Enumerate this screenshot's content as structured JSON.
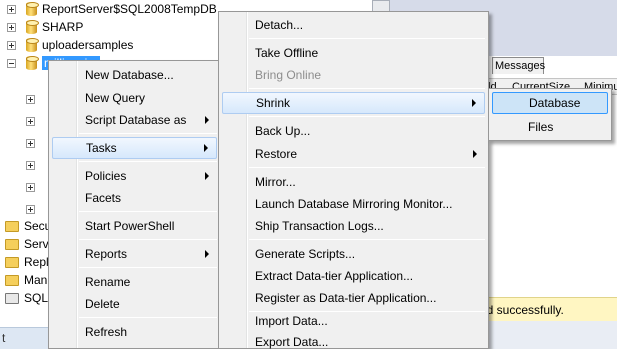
{
  "tree": {
    "items": [
      {
        "label": "ReportServer$SQL2008TempDB",
        "type": "database"
      },
      {
        "label": "SHARP",
        "type": "database"
      },
      {
        "label": "uploadersamples",
        "type": "database"
      },
      {
        "label": "millionaire",
        "type": "database",
        "selected": true
      }
    ],
    "folders": [
      {
        "label": "Secu"
      },
      {
        "label": "Serv"
      },
      {
        "label": "Repl"
      },
      {
        "label": "Man"
      },
      {
        "label": "SQL"
      }
    ],
    "status_text": "t"
  },
  "results": {
    "messages_tab": "Messages",
    "columns": [
      "ld",
      "CurrentSize",
      "Minimu"
    ],
    "status_message": "ed successfully."
  },
  "context_menu": {
    "items": [
      {
        "label": "New Database..."
      },
      {
        "label": "New Query"
      },
      {
        "label": "Script Database as",
        "submenu": true
      },
      {
        "label": "Tasks",
        "submenu": true,
        "highlighted": true
      },
      {
        "label": "Policies",
        "submenu": true
      },
      {
        "label": "Facets"
      },
      {
        "label": "Start PowerShell"
      },
      {
        "label": "Reports",
        "submenu": true
      },
      {
        "label": "Rename"
      },
      {
        "label": "Delete"
      },
      {
        "label": "Refresh"
      }
    ]
  },
  "tasks_menu": {
    "items": [
      {
        "label": "Detach..."
      },
      {
        "label": "Take Offline"
      },
      {
        "label": "Bring Online",
        "disabled": true
      },
      {
        "label": "Shrink",
        "submenu": true,
        "highlighted": true
      },
      {
        "label": "Back Up..."
      },
      {
        "label": "Restore",
        "submenu": true
      },
      {
        "label": "Mirror..."
      },
      {
        "label": "Launch Database Mirroring Monitor..."
      },
      {
        "label": "Ship Transaction Logs..."
      },
      {
        "label": "Generate Scripts..."
      },
      {
        "label": "Extract Data-tier Application..."
      },
      {
        "label": "Register as Data-tier Application..."
      },
      {
        "label": "Import Data..."
      },
      {
        "label": "Export Data..."
      }
    ]
  },
  "shrink_menu": {
    "items": [
      {
        "label": "Database",
        "highlighted": true
      },
      {
        "label": "Files"
      }
    ]
  }
}
